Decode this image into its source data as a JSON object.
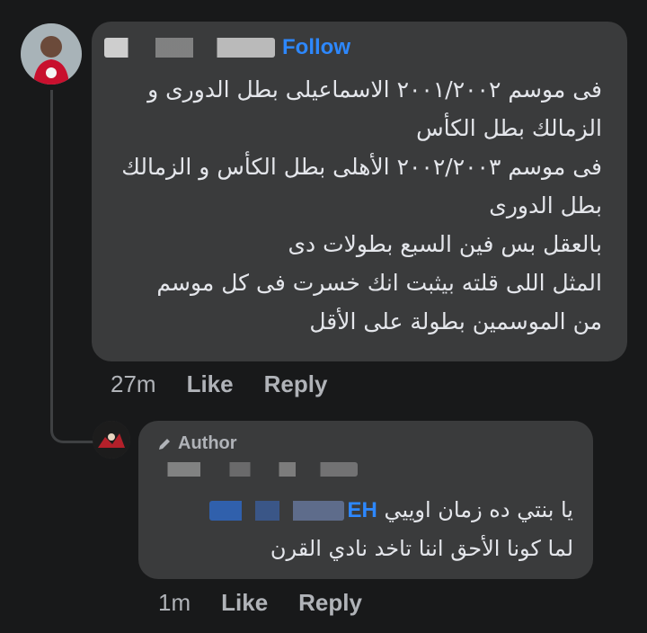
{
  "comment": {
    "follow_label": "Follow",
    "lines": [
      "فى موسم ٢٠٠١/٢٠٠٢ الاسماعيلى بطل الدورى و",
      "الزمالك بطل الكأس",
      "فى موسم ٢٠٠٢/٢٠٠٣ الأهلى بطل الكأس و الزمالك",
      "بطل الدورى",
      "بالعقل بس فين السبع بطولات دى",
      "المثل اللى قلته بيثبت انك خسرت فى كل موسم",
      "من الموسمين بطولة على الأقل"
    ],
    "time": "27m",
    "like": "Like",
    "reply": "Reply"
  },
  "reply": {
    "badge": "Author",
    "mention_visible": "EH",
    "line1": "يا بنتي ده زمان اوييي",
    "line2": "لما كونا الأحق اننا تاخد نادي القرن",
    "time": "1m",
    "like": "Like",
    "reply": "Reply"
  },
  "colors": {
    "background": "#18191a",
    "bubble": "#3a3b3c",
    "link": "#2d88ff",
    "secondary_text": "#b0b3b8"
  },
  "icons": [
    "avatar",
    "pencil-icon"
  ]
}
